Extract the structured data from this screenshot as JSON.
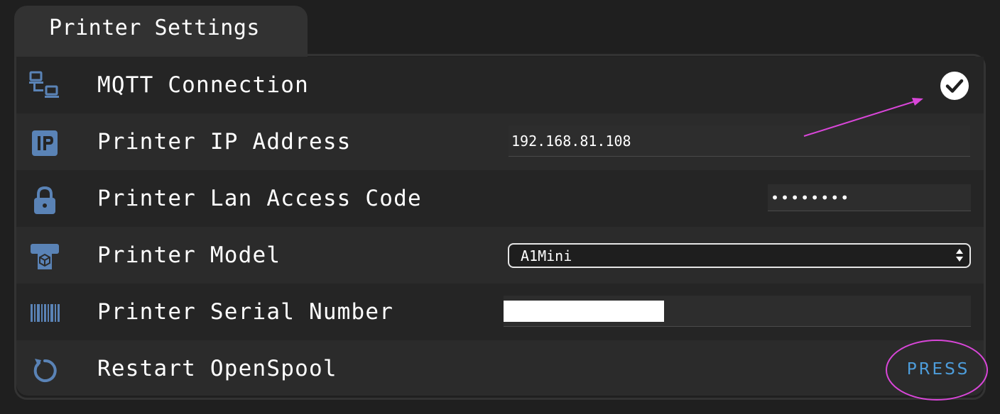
{
  "section": {
    "title": "Printer Settings"
  },
  "rows": [
    {
      "label": "MQTT Connection",
      "icon": "network-icon",
      "status": "connected"
    },
    {
      "label": "Printer IP Address",
      "icon": "ip-icon",
      "value": "192.168.81.108"
    },
    {
      "label": "Printer Lan Access Code",
      "icon": "lock-icon",
      "value": "••••••••"
    },
    {
      "label": "Printer Model",
      "icon": "printer-icon",
      "value": "A1Mini"
    },
    {
      "label": "Printer Serial Number",
      "icon": "barcode-icon",
      "value": ""
    },
    {
      "label": "Restart OpenSpool",
      "icon": "restart-icon",
      "button": "PRESS"
    }
  ],
  "colors": {
    "icon": "#5a83b6",
    "accent": "#4d9ddb",
    "annotation": "#d946d9",
    "background": "#1f1f1f"
  }
}
